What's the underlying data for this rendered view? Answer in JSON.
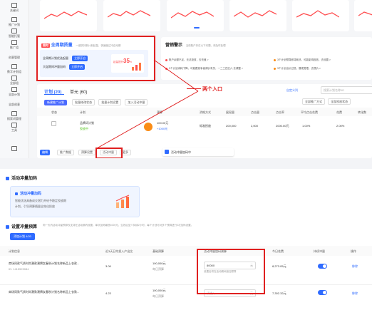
{
  "sidebar": {
    "items": [
      {
        "label": "关键词"
      },
      {
        "label": "推广计划"
      },
      {
        "label": "智能托管"
      },
      {
        "label": "推广组"
      },
      {
        "label": "创意管理"
      },
      {
        "label": "数字计划组"
      },
      {
        "label": "全部组"
      },
      {
        "label": "全部计划"
      },
      {
        "label": "全部创意"
      },
      {
        "label": "搜索词管理"
      },
      {
        "label": "工具"
      },
      {
        "label": "效果分析"
      }
    ]
  },
  "promo": {
    "badge": "限时",
    "title": "全周期扬量",
    "subtitle": "一键扶持新计划起量，快速度过冷启动期",
    "rows": [
      {
        "text": "全周期计划优选起量",
        "button": "立即开启"
      },
      {
        "text": "大促期间冲量加码",
        "button": "立即开启"
      }
    ],
    "percent": "35",
    "percent_prefix": "起量提升",
    "percent_suffix": "%"
  },
  "notice": {
    "title": "营销警示",
    "subtitle": "当前账户存在以下问题，请及时处理",
    "items": [
      "账户余额不足，无法投放，去充值 >",
      "3个计划预算即将耗尽，可能影响投放，去设置 >",
      "3个计划消耗下降，可能跟竞争者调价有关，一二三四五六 去调整 >",
      "3个计划出价过低，展现受限，去提价 >"
    ]
  },
  "annotation": {
    "text": "两个入口"
  },
  "tabs": {
    "plan": "计划 (20)",
    "unit": "单元 (60)"
  },
  "toolbar": {
    "new_plan": "新建推广计划",
    "filter1": "批量修改状态",
    "filter2": "批量计划设置",
    "filter3": "加入活动冲量",
    "custom_cols": "自定义列",
    "search_placeholder": "搜索计划名称/ID",
    "select1": "全部推广方式",
    "select2": "全部投放状态"
  },
  "table": {
    "headers": [
      "状态",
      "计划",
      "预算",
      "消耗方式",
      "展现量",
      "点击量",
      "点击率",
      "平均点击花费",
      "花费",
      "转化数"
    ],
    "row": {
      "name": "品牌词计划",
      "status": "投放中",
      "budget": "100.00元",
      "budget_note": "+1000元",
      "method": "标准投放",
      "impressions": "200,000",
      "clicks": "2,000",
      "cost": "2000.00元",
      "ctr": "1.00%",
      "rate2": "2.00%"
    },
    "actions": [
      "编辑",
      "推广数据",
      "预算设置",
      "活动冲量",
      "更多"
    ]
  },
  "entry_tip": {
    "label": "活动冲量加码中"
  },
  "bottom": {
    "section_title": "活动冲量加码",
    "feature_card": {
      "title": "活动冲量加码",
      "desc1": "智能优选具备成交潜力并给予稳定投放期",
      "desc2": "计划，引导预算随量全效化投放"
    },
    "budget_section": {
      "title": "设置冲量预算",
      "hint": "同一天内活动冲量预算仅支持在活动期内设置，单次加码最低4000元，生效后至少持续2小时，每个计划可对多个预算进行2次加码设置。",
      "add_button": "添加计划 4/20"
    },
    "columns": [
      "计划信息",
      "近3天日均投入产出比",
      "基础预算",
      "活动冲量加码预算",
      "今日花费",
      "持续冲量",
      "操作"
    ],
    "rows": [
      {
        "name": "商场同款气质时尚潮款潮牌女春秋计划名称新品上衣款...",
        "id": "ID: 1415523084",
        "roi": "3.09",
        "budget": "100,000元",
        "budget_sub": "每日预算",
        "extra_budget": "80000",
        "extra_unit": "元",
        "extra_hint": "设置后将在活动期间追加预算",
        "spend": "8,273.05元",
        "action": "移除"
      },
      {
        "name": "商场同款气质时尚潮款潮牌女春秋计划名称新品上衣款...",
        "id": "",
        "roi": "4.23",
        "budget": "100,000元",
        "budget_sub": "每日预算",
        "extra_budget": "",
        "extra_placeholder": "请输入",
        "extra_unit": "元",
        "extra_hint": "",
        "spend": "7,302.32元",
        "action": "移除"
      }
    ]
  },
  "colors": {
    "accent": "#2f6bff",
    "highlight": "#e02020",
    "promo_bg": "#f0f5ff"
  }
}
